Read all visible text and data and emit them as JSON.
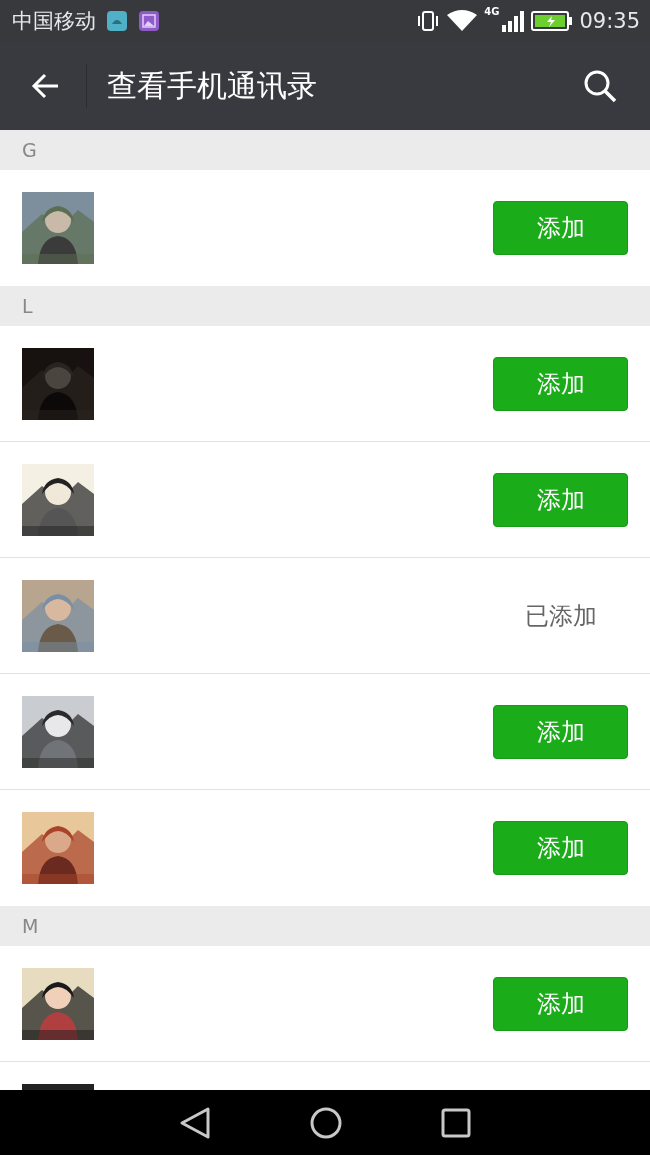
{
  "status_bar": {
    "carrier": "中国移动",
    "network": "4G",
    "time": "09:35"
  },
  "toolbar": {
    "title": "查看手机通讯录"
  },
  "sections": [
    {
      "letter": "G",
      "contacts": [
        {
          "avatar": {
            "kind": "picture"
          },
          "action": "添加",
          "added": false
        }
      ]
    },
    {
      "letter": "L",
      "contacts": [
        {
          "avatar": {
            "kind": "picture"
          },
          "action": "添加",
          "added": false
        },
        {
          "avatar": {
            "kind": "picture"
          },
          "action": "添加",
          "added": false
        },
        {
          "avatar": {
            "kind": "picture"
          },
          "action": "已添加",
          "added": true
        },
        {
          "avatar": {
            "kind": "picture"
          },
          "action": "添加",
          "added": false
        },
        {
          "avatar": {
            "kind": "picture"
          },
          "action": "添加",
          "added": false
        }
      ]
    },
    {
      "letter": "M",
      "contacts": [
        {
          "avatar": {
            "kind": "picture"
          },
          "action": "添加",
          "added": false
        },
        {
          "avatar": {
            "kind": "picture"
          }
        }
      ]
    }
  ]
}
